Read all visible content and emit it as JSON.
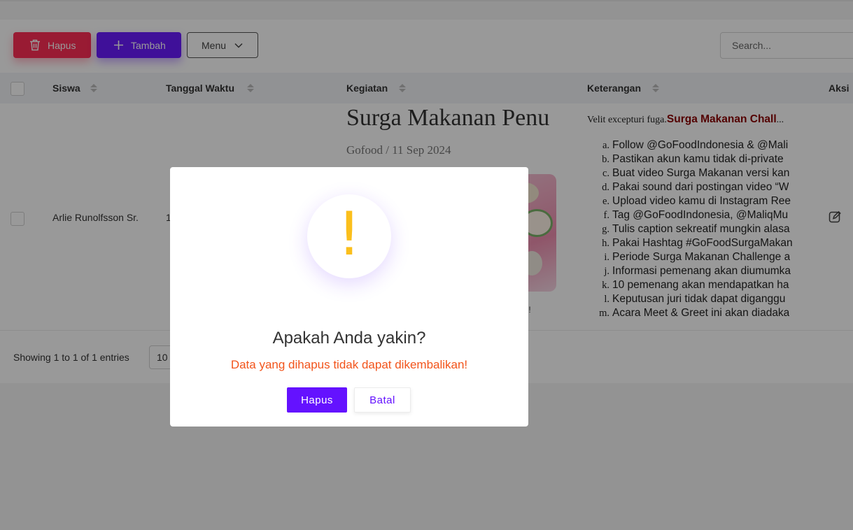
{
  "toolbar": {
    "delete_label": "Hapus",
    "add_label": "Tambah",
    "menu_label": "Menu",
    "search_placeholder": "Search..."
  },
  "table": {
    "columns": [
      "Siswa",
      "Tanggal Waktu",
      "Kegiatan",
      "Keterangan",
      "Aksi"
    ],
    "row": {
      "siswa": "Arlie Runolfsson Sr.",
      "tanggal_partial": "1",
      "kegiatan_title": "Surga Makanan Penu",
      "kegiatan_meta": "Gofood / 11 Sep 2024",
      "kegiatan_tail": "als!",
      "keterangan_intro": "Velit excepturi fuga.",
      "keterangan_highlight": "Surga Makanan Chall",
      "keterangan_ellipsis": "...",
      "keterangan_items": [
        {
          "marker": "a.",
          "text": "Follow @GoFoodIndonesia & @Mali"
        },
        {
          "marker": "b.",
          "text": "Pastikan akun kamu tidak di-private"
        },
        {
          "marker": "c.",
          "text": "Buat video Surga Makanan versi kan"
        },
        {
          "marker": "d.",
          "text": "Pakai sound dari postingan video “W"
        },
        {
          "marker": "e.",
          "text": "Upload video kamu di Instagram Ree"
        },
        {
          "marker": "f.",
          "text": "Tag @GoFoodIndonesia, @MaliqMu"
        },
        {
          "marker": "g.",
          "text": "Tulis caption sekreatif mungkin alasa"
        },
        {
          "marker": "h.",
          "text": "Pakai Hashtag #GoFoodSurgaMakan"
        },
        {
          "marker": "i.",
          "text": "Periode Surga Makanan Challenge a"
        },
        {
          "marker": "j.",
          "text": "Informasi pemenang akan diumumka"
        },
        {
          "marker": "k.",
          "text": "10 pemenang akan mendapatkan ha"
        },
        {
          "marker": "l.",
          "text": "Keputusan juri tidak dapat diganggu"
        },
        {
          "marker": "m.",
          "text": "Acara Meet & Greet ini akan diadaka"
        }
      ]
    }
  },
  "footer": {
    "entries_text": "Showing 1 to 1 of 1 entries",
    "page_size": "10"
  },
  "modal": {
    "icon_glyph": "!",
    "title": "Apakah Anda yakin?",
    "text": "Data yang dihapus tidak dapat dikembalikan!",
    "confirm_label": "Hapus",
    "cancel_label": "Batal"
  },
  "colors": {
    "delete_button": "#ff2d55",
    "add_button": "#6a1bff",
    "modal_confirm": "#6412ff",
    "warning_icon": "#fbbf1c",
    "modal_text": "#f2541b"
  }
}
